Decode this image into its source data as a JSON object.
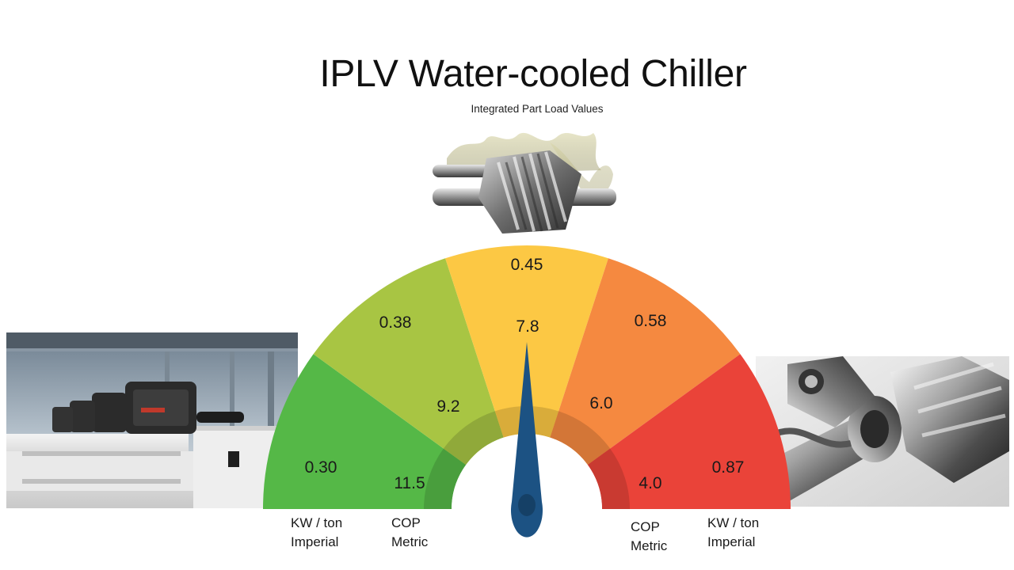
{
  "title": "IPLV Water-cooled Chiller",
  "subtitle": "Integrated Part Load Values",
  "gauge": {
    "segments": [
      {
        "color": "#55b847",
        "kw_ton": "0.30",
        "cop": "11.5"
      },
      {
        "color": "#a8c543",
        "kw_ton": "0.38",
        "cop": "9.2"
      },
      {
        "color": "#fcc844",
        "kw_ton": "0.45",
        "cop": "7.8"
      },
      {
        "color": "#f58940",
        "kw_ton": "0.58",
        "cop": "6.0"
      },
      {
        "color": "#ea4339",
        "kw_ton": "0.87",
        "cop": "4.0"
      }
    ],
    "needle_color": "#1c5283"
  },
  "legend": {
    "left_outer": {
      "line1": "KW / ton",
      "line2": "Imperial"
    },
    "left_inner": {
      "line1": "COP",
      "line2": "Metric"
    },
    "right_inner": {
      "line1": "COP",
      "line2": "Metric"
    },
    "right_outer": {
      "line1": "KW / ton",
      "line2": "Imperial"
    }
  },
  "images": {
    "left": "chiller-plant-photo",
    "top": "screw-compressor-rotors-photo",
    "right": "compressor-mechanism-photo"
  }
}
